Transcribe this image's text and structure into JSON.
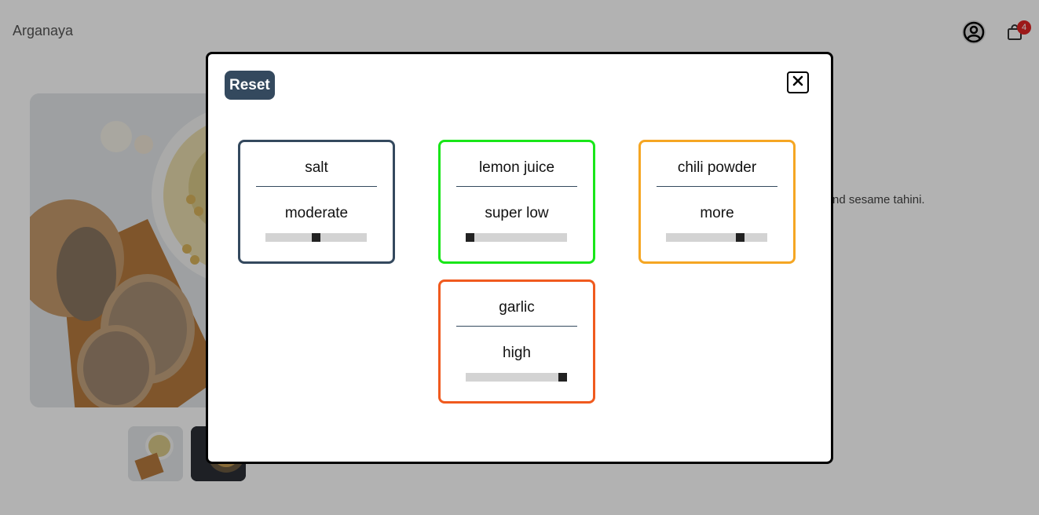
{
  "header": {
    "brand": "Arganaya",
    "cart_count": "4",
    "icons": [
      "user-circle-icon",
      "shopping-bag-icon"
    ]
  },
  "product": {
    "description_snippet": "s and sesame tahini."
  },
  "modal": {
    "reset_label": "Reset",
    "close_icon": "close-icon",
    "ingredients": [
      {
        "name": "salt",
        "level": "moderate",
        "level_fraction": 0.5,
        "color": "#34495e"
      },
      {
        "name": "lemon juice",
        "level": "super low",
        "level_fraction": 0.0,
        "color": "#19e619"
      },
      {
        "name": "chili powder",
        "level": "more",
        "level_fraction": 0.75,
        "color": "#f5a623"
      },
      {
        "name": "garlic",
        "level": "high",
        "level_fraction": 1.0,
        "color": "#f05a1e"
      }
    ]
  },
  "colors": {
    "reset_button": "#34495e",
    "badge": "#e02424"
  }
}
